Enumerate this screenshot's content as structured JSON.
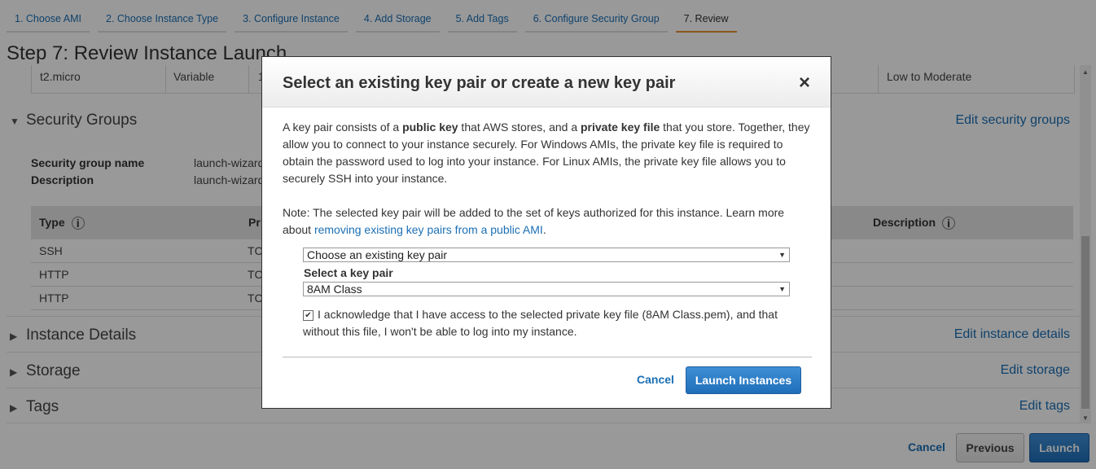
{
  "wizard": {
    "steps": [
      "1. Choose AMI",
      "2. Choose Instance Type",
      "3. Configure Instance",
      "4. Add Storage",
      "5. Add Tags",
      "6. Configure Security Group",
      "7. Review"
    ],
    "page_title": "Step 7: Review Instance Launch"
  },
  "instance_row": {
    "type": "t2.micro",
    "ecu": "Variable",
    "col3": "1",
    "network": "Low to Moderate"
  },
  "security_groups": {
    "title": "Security Groups",
    "edit_label": "Edit security groups",
    "name_label": "Security group name",
    "name_value": "launch-wizard",
    "description_label": "Description",
    "description_value": "launch-wizard",
    "columns": {
      "type": "Type",
      "protocol": "Pr",
      "description": "Description"
    },
    "rows": [
      {
        "type": "SSH",
        "protocol": "TC"
      },
      {
        "type": "HTTP",
        "protocol": "TC"
      },
      {
        "type": "HTTP",
        "protocol": "TC"
      }
    ]
  },
  "sections": {
    "instance_details": {
      "title": "Instance Details",
      "edit": "Edit instance details"
    },
    "storage": {
      "title": "Storage",
      "edit": "Edit storage"
    },
    "tags": {
      "title": "Tags",
      "edit": "Edit tags"
    }
  },
  "footer": {
    "cancel": "Cancel",
    "previous": "Previous",
    "launch": "Launch"
  },
  "modal": {
    "title": "Select an existing key pair or create a new key pair",
    "close": "×",
    "para1": {
      "t1": "A key pair consists of a ",
      "b1": "public key",
      "t2": " that AWS stores, and a ",
      "b2": "private key file",
      "t3": " that you store. Together, they allow you to connect to your instance securely. For Windows AMIs, the private key file is required to obtain the password used to log into your instance. For Linux AMIs, the private key file allows you to securely SSH into your instance."
    },
    "para2": {
      "text": "Note: The selected key pair will be added to the set of keys authorized for this instance. Learn more about ",
      "link": "removing existing key pairs from a public AMI",
      "end": "."
    },
    "choice_select": "Choose an existing key pair",
    "key_pair_label": "Select a key pair",
    "key_pair_select": "8AM Class",
    "ack_text": "I acknowledge that I have access to the selected private key file (8AM Class.pem), and that without this file, I won't be able to log into my instance.",
    "cancel": "Cancel",
    "launch": "Launch Instances"
  }
}
